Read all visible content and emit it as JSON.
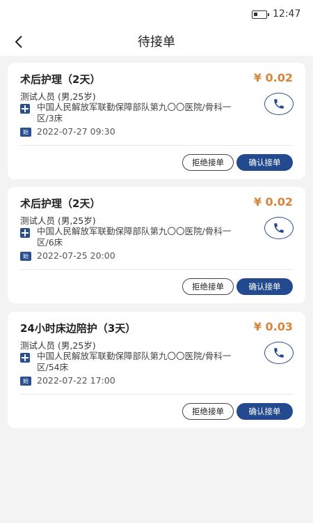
{
  "status_bar": {
    "time": "12:47",
    "battery_icon": "battery-icon"
  },
  "header": {
    "title": "待接单",
    "back_icon": "chevron-left-icon"
  },
  "colors": {
    "accent": "#234a8f",
    "price": "#d8843c",
    "background": "#f3f3f3"
  },
  "orders": [
    {
      "title": "术后护理（2天）",
      "price": "¥ 0.02",
      "patient": "测试人员 (男,25岁)",
      "hospital": "中国人民解放军联勤保障部队第九〇〇医院/骨科一区/3床",
      "start_label": "始",
      "start_time": "2022-07-27 09:30",
      "reject_label": "拒绝接单",
      "confirm_label": "确认接单"
    },
    {
      "title": "术后护理（2天）",
      "price": "¥ 0.02",
      "patient": "测试人员 (男,25岁)",
      "hospital": "中国人民解放军联勤保障部队第九〇〇医院/骨科一区/6床",
      "start_label": "始",
      "start_time": "2022-07-25 20:00",
      "reject_label": "拒绝接单",
      "confirm_label": "确认接单"
    },
    {
      "title": "24小时床边陪护（3天）",
      "price": "¥ 0.03",
      "patient": "测试人员 (男,25岁)",
      "hospital": "中国人民解放军联勤保障部队第九〇〇医院/骨科一区/54床",
      "start_label": "始",
      "start_time": "2022-07-22 17:00",
      "reject_label": "拒绝接单",
      "confirm_label": "确认接单"
    }
  ]
}
